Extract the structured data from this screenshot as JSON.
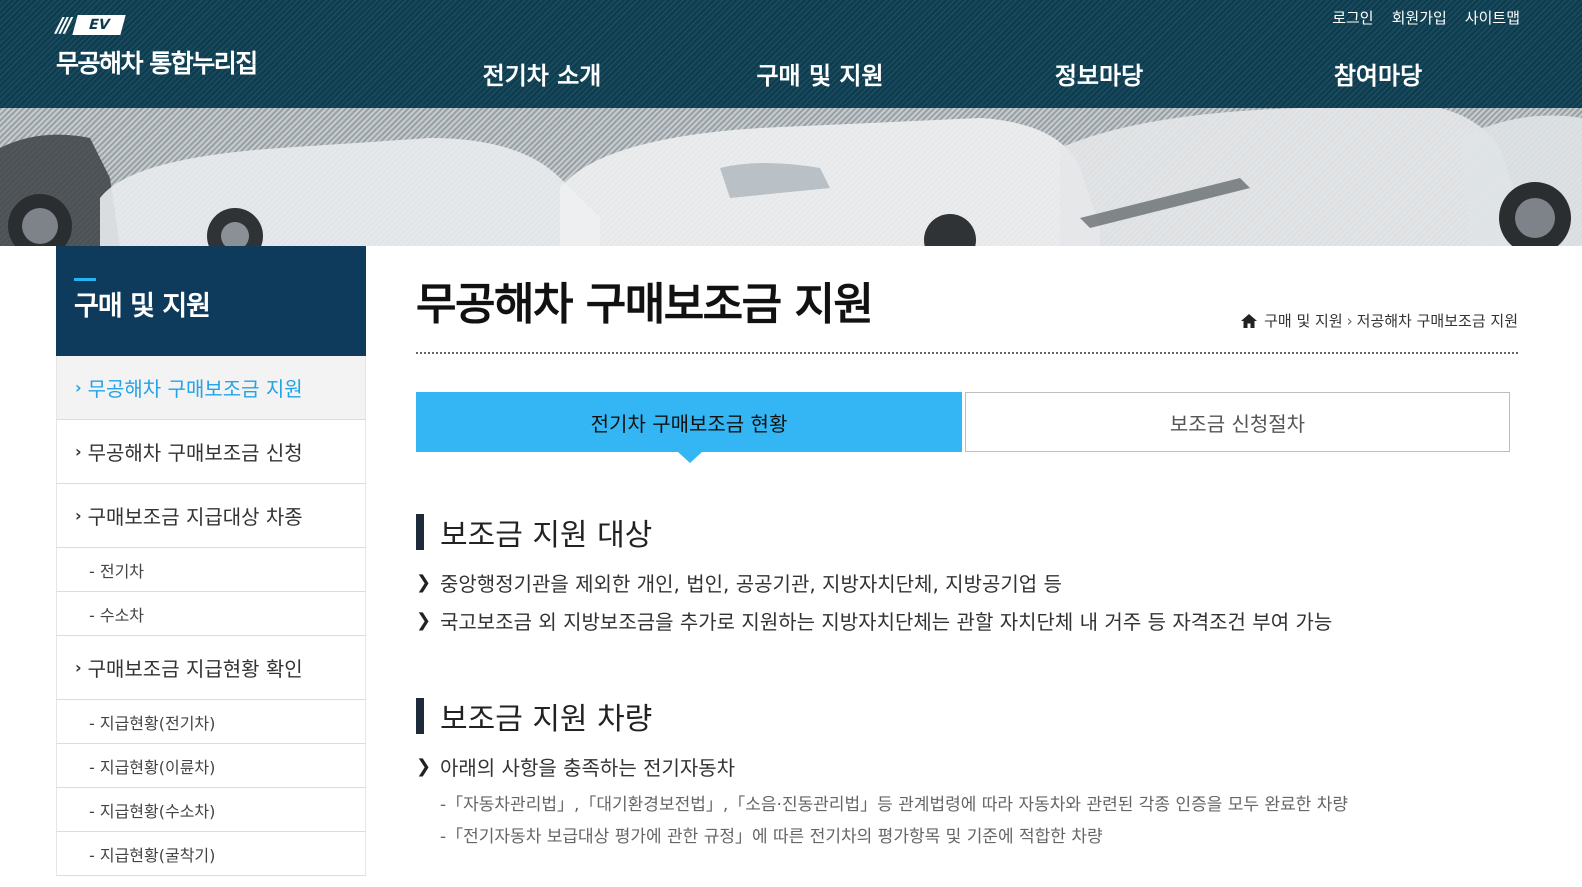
{
  "header": {
    "logo_mark": "///",
    "logo_ev": "EV",
    "logo_title": "무공해차 통합누리집",
    "util": [
      "로그인",
      "회원가입",
      "사이트맵"
    ],
    "gnb": [
      "전기차 소개",
      "구매 및 지원",
      "정보마당",
      "참여마당"
    ]
  },
  "sidebar": {
    "title": "구매 및 지원",
    "items": [
      {
        "label": "무공해차 구매보조금 지원",
        "type": "main",
        "active": true
      },
      {
        "label": "무공해차 구매보조금 신청",
        "type": "main"
      },
      {
        "label": "구매보조금 지급대상 차종",
        "type": "main"
      },
      {
        "label": "- 전기차",
        "type": "sub"
      },
      {
        "label": "- 수소차",
        "type": "sub"
      },
      {
        "label": "구매보조금 지급현황 확인",
        "type": "main"
      },
      {
        "label": "- 지급현황(전기차)",
        "type": "sub"
      },
      {
        "label": "- 지급현황(이륜차)",
        "type": "sub"
      },
      {
        "label": "- 지급현황(수소차)",
        "type": "sub"
      },
      {
        "label": "- 지급현황(굴착기)",
        "type": "sub"
      }
    ]
  },
  "main": {
    "page_title": "무공해차 구매보조금 지원",
    "breadcrumb": [
      "구매 및 지원",
      "저공해차 구매보조금 지원"
    ],
    "tabs": [
      {
        "label": "전기차 구매보조금 현황",
        "active": true
      },
      {
        "label": "보조금 신청절차",
        "active": false
      }
    ],
    "sections": [
      {
        "title": "보조금 지원 대상",
        "bullets": [
          "중앙행정기관을 제외한 개인, 법인, 공공기관, 지방자치단체, 지방공기업 등",
          "국고보조금 외 지방보조금을 추가로 지원하는 지방자치단체는 관할 자치단체 내 거주 등 자격조건 부여 가능"
        ]
      },
      {
        "title": "보조금 지원 차량",
        "bullets": [
          "아래의 사항을 충족하는 전기자동차"
        ],
        "sub_lines": [
          "-「자동차관리법」,「대기환경보전법」,「소음·진동관리법」등 관계법령에 따라 자동차와 관련된 각종 인증을 모두 완료한 차량",
          "-「전기자동차 보급대상 평가에 관한 규정」에 따른 전기차의 평가항목 및 기준에 적합한 차량"
        ]
      }
    ]
  },
  "colors": {
    "header_bg": "#0f3a4c",
    "lnb_head_bg": "#0e3a5c",
    "accent": "#33b6f3",
    "active_text": "#23a3e8"
  }
}
